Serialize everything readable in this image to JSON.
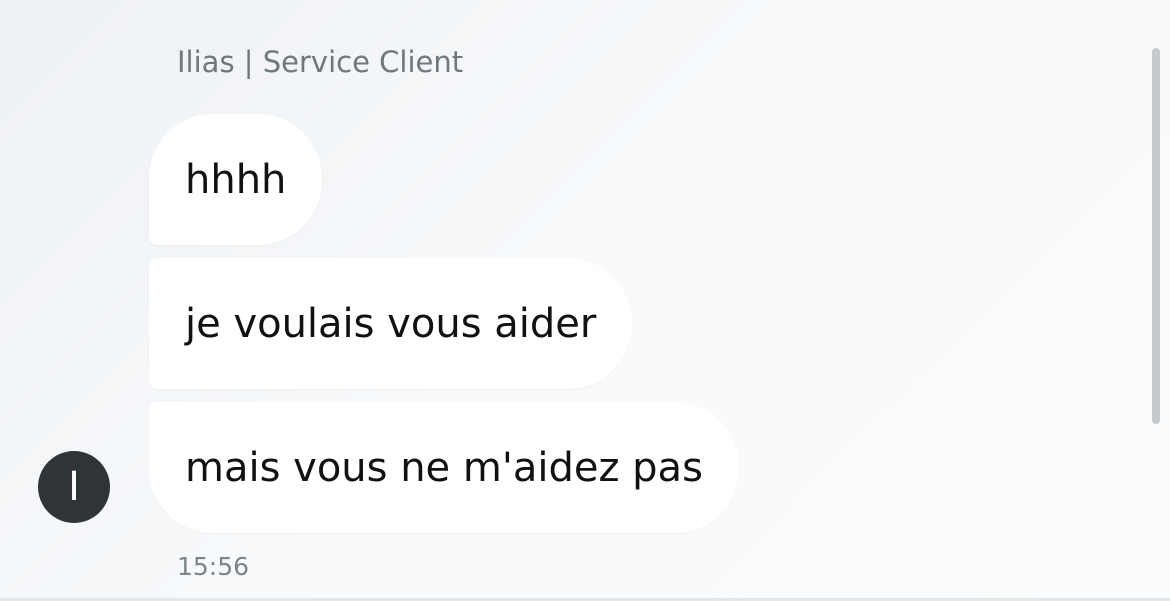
{
  "chat": {
    "sender_name": "Ilias | Service Client",
    "messages": [
      {
        "text": "hhhh"
      },
      {
        "text": "je voulais vous aider"
      },
      {
        "text": "mais vous ne m'aidez pas"
      }
    ],
    "avatar_initial": "I",
    "timestamp": "15:56"
  }
}
